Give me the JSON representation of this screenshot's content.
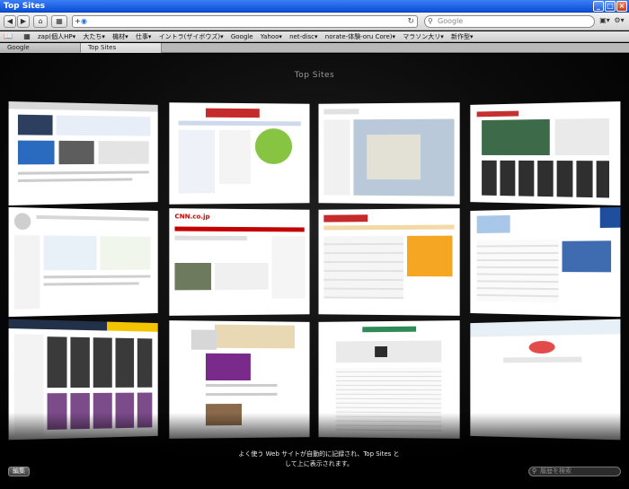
{
  "window": {
    "title": "Top Sites",
    "buttons": [
      "_",
      "□",
      "×"
    ]
  },
  "toolbar": {
    "back": "◀",
    "forward": "▶",
    "home": "⌂",
    "add": "+",
    "url_icon": "globe-icon",
    "url_value": "",
    "search_placeholder": "Google",
    "page_menu": "▣▾",
    "settings": "⚙▾"
  },
  "bookmarks": {
    "items": [
      "zap(個人HP▾",
      "大たち▾",
      "機材▾",
      "仕事▾",
      "イントラ(ザイボウズ)▾",
      "Google",
      "Yahoo▾",
      "net-disc▾",
      "norate-体験-oru Core)▾",
      "マラソン大リ▾",
      "新作型▾"
    ]
  },
  "tabs": [
    {
      "label": "Google"
    },
    {
      "label": "Top Sites"
    }
  ],
  "topsites": {
    "title": "Top Sites",
    "description": "よく使う Web サイトが自動的に記録され、Top Sites として上に表示されます。",
    "edit_label": "編集",
    "search_placeholder": "履歴を検索"
  },
  "thumbnails": [
    {
      "id": "apple"
    },
    {
      "id": "yahoo-jp"
    },
    {
      "id": "google-maps"
    },
    {
      "id": "video-site"
    },
    {
      "id": "wikipedia"
    },
    {
      "id": "cnn-jp",
      "logo": "CNN.co.jp"
    },
    {
      "id": "yahoo-shopping"
    },
    {
      "id": "microsoft-sql"
    },
    {
      "id": "amazon-jp"
    },
    {
      "id": "dog-blog"
    },
    {
      "id": "news-list"
    },
    {
      "id": "blank-search"
    }
  ]
}
